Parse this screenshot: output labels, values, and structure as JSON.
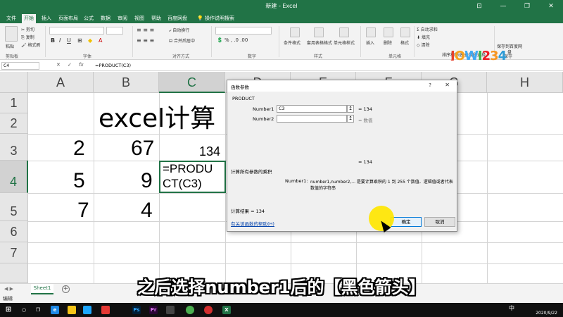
{
  "window": {
    "title": "新建 - Excel",
    "minimize": "—",
    "restore": "❐",
    "close": "✕",
    "account": "⊡"
  },
  "ribbon_tabs": [
    {
      "label": "文件"
    },
    {
      "label": "开始"
    },
    {
      "label": "插入"
    },
    {
      "label": "页面布局"
    },
    {
      "label": "公式"
    },
    {
      "label": "数据"
    },
    {
      "label": "审阅"
    },
    {
      "label": "视图"
    },
    {
      "label": "帮助"
    },
    {
      "label": "百度网盘"
    }
  ],
  "search_hint": "操作说明搜索",
  "ribbon": {
    "clipboard": {
      "paste": "粘贴",
      "cut": "剪切",
      "copy": "复制",
      "format_painter": "格式刷",
      "group": "剪贴板"
    },
    "font": {
      "group": "字体"
    },
    "alignment": {
      "wrap": "自动换行",
      "merge": "合并后居中",
      "group": "对齐方式"
    },
    "number": {
      "group": "数字"
    },
    "styles": {
      "conditional": "条件格式",
      "table": "套用表格格式",
      "cell_styles": "单元格样式",
      "group": "样式"
    },
    "cells": {
      "insert": "插入",
      "delete": "删除",
      "format": "格式",
      "group": "单元格"
    },
    "editing": {
      "autosum": "自动求和",
      "fill": "填充",
      "clear": "清除",
      "sort": "排序和筛选",
      "find": "查找和选择",
      "group": "编辑"
    },
    "save": {
      "label": "保存到百度网盘",
      "group": "保存"
    }
  },
  "logo": {
    "letters": [
      "J",
      "O",
      "W",
      "I",
      "2",
      "3",
      "4"
    ],
    "colors": [
      "#e8412b",
      "#f7a21b",
      "#3fa9f5",
      "#37b34a",
      "#ed1c24",
      "#f7941d",
      "#2e9bd6"
    ]
  },
  "formula_bar": {
    "name_box": "C4",
    "cancel": "✕",
    "enter": "✓",
    "fx": "fx",
    "formula": "=PRODUCT(C3)"
  },
  "columns": [
    "A",
    "B",
    "C",
    "D",
    "E",
    "F",
    "G",
    "H"
  ],
  "rows": [
    "1",
    "2",
    "3",
    "4",
    "5",
    "6",
    "7"
  ],
  "cells": {
    "title": "excel计算",
    "a3": "2",
    "b3": "67",
    "c3": "134",
    "a4": "5",
    "b4": "9",
    "c4_line1": "=PRODU",
    "c4_line2": "CT(C3)",
    "a5": "7",
    "b5": "4"
  },
  "dialog": {
    "title": "函数参数",
    "help": "?",
    "close": "✕",
    "function_name": "PRODUCT",
    "arg1_label": "Number1",
    "arg1_value": "C3",
    "arg1_result": "= 134",
    "arg2_label": "Number2",
    "arg2_result": "= 数值",
    "collapse": "↥",
    "total_result": "= 134",
    "description": "计算所有参数的乘积",
    "arg_help_label": "Number1:",
    "arg_help_line1": "number1,number2,... 是要计算乘积的 1 到 255 个数值、逻辑值或者代表",
    "arg_help_line2": "数值的字符串",
    "calc_result": "计算结果 = 134",
    "help_link": "有关该函数的帮助(H)",
    "ok": "确定",
    "cancel": "取消"
  },
  "sheet": {
    "tab": "Sheet1",
    "add": "+"
  },
  "status": {
    "mode": "编辑"
  },
  "subtitle": "之后选择number1后的【黑色箭头】",
  "taskbar": {
    "ime": "中",
    "date": "2020/9/22"
  }
}
